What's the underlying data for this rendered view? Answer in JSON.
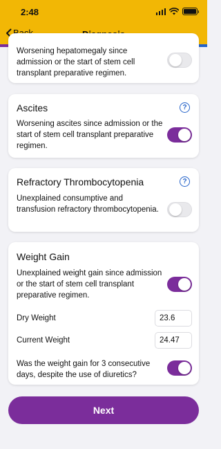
{
  "status_bar": {
    "time": "2:48"
  },
  "nav": {
    "back_label": "Back",
    "title": "Diagnosis"
  },
  "colors": {
    "nav_bg": "#f2b705",
    "accent": "#7b2d9b",
    "help": "#2563c9",
    "stripe": [
      "#7b2d9b",
      "#e8a26a",
      "#e34234",
      "#2e9c47",
      "#2563c9"
    ]
  },
  "cards": [
    {
      "description": "Worsening hepatomegaly since admission or the start of stem cell transplant preparative regimen.",
      "toggle_on": false
    },
    {
      "title": "Ascites",
      "description": "Worsening ascites since admission or the start of stem cell transplant preparative regimen.",
      "toggle_on": true
    },
    {
      "title": "Refractory Thrombocytopenia",
      "description": "Unexplained consumptive and transfusion refractory thrombocytopenia.",
      "toggle_on": false
    },
    {
      "title": "Weight Gain",
      "description": "Unexplained weight gain since admission or the start of stem cell transplant preparative regimen.",
      "toggle_on": true,
      "dry_weight_label": "Dry Weight",
      "dry_weight_value": "23.6",
      "current_weight_label": "Current Weight",
      "current_weight_value": "24.47",
      "diuretics_question": "Was the weight gain for 3 consecutive days, despite the use of diuretics?",
      "diuretics_toggle_on": true
    }
  ],
  "icons": {
    "help": "question-circle-icon",
    "back": "chevron-left-icon"
  },
  "next_label": "Next"
}
